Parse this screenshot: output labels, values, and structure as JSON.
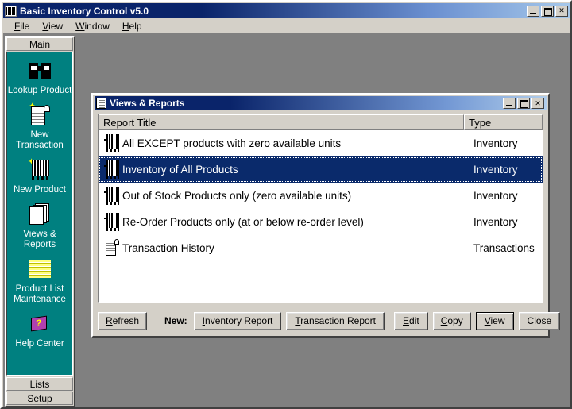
{
  "app": {
    "title": "Basic Inventory Control v5.0",
    "icon": "barcode-icon",
    "window_controls": {
      "minimize": "_",
      "maximize": "□",
      "close": "✕"
    }
  },
  "menubar": {
    "items": [
      {
        "label": "File",
        "accel": "F"
      },
      {
        "label": "View",
        "accel": "V"
      },
      {
        "label": "Window",
        "accel": "W"
      },
      {
        "label": "Help",
        "accel": "H"
      }
    ]
  },
  "sidebar": {
    "top_tab": "Main",
    "bottom_tabs": [
      "Lists",
      "Setup"
    ],
    "items": [
      {
        "label": "Lookup Product",
        "icon": "binoculars-icon"
      },
      {
        "label": "New\nTransaction",
        "icon": "new-transaction-scroll-icon"
      },
      {
        "label": "New Product",
        "icon": "new-product-barcode-icon"
      },
      {
        "label": "Views & Reports",
        "icon": "pages-icon"
      },
      {
        "label": "Product List\nMaintenance",
        "icon": "product-list-stripes-icon"
      },
      {
        "label": "Help Center",
        "icon": "help-book-icon"
      }
    ]
  },
  "dialog": {
    "title": "Views & Reports",
    "icon": "clipboard-icon",
    "window_controls": {
      "minimize": "_",
      "maximize": "□",
      "close": "✕"
    },
    "columns": [
      {
        "key": "title",
        "label": "Report Title"
      },
      {
        "key": "type",
        "label": "Type"
      }
    ],
    "rows": [
      {
        "title": "All EXCEPT products with zero available units",
        "type": "Inventory",
        "icon": "barcode-row-icon",
        "selected": false
      },
      {
        "title": "Inventory of All Products",
        "type": "Inventory",
        "icon": "barcode-row-icon",
        "selected": true
      },
      {
        "title": "Out of Stock Products only (zero available units)",
        "type": "Inventory",
        "icon": "barcode-row-icon",
        "selected": false
      },
      {
        "title": "Re-Order Products only (at or below re-order level)",
        "type": "Inventory",
        "icon": "barcode-row-icon",
        "selected": false
      },
      {
        "title": "Transaction History",
        "type": "Transactions",
        "icon": "scroll-row-icon",
        "selected": false
      }
    ],
    "buttons": {
      "refresh": {
        "label": "Refresh",
        "accel": "R"
      },
      "new_label": "New:",
      "inventory_report": {
        "label": "Inventory Report",
        "accel": "I"
      },
      "transaction_report": {
        "label": "Transaction Report",
        "accel": "T"
      },
      "edit": {
        "label": "Edit",
        "accel": "E"
      },
      "copy": {
        "label": "Copy",
        "accel": "C"
      },
      "view": {
        "label": "View",
        "accel": "V",
        "default": true
      },
      "close": {
        "label": "Close",
        "accel": ""
      }
    }
  },
  "colors": {
    "titlebar_start": "#0a246a",
    "titlebar_end": "#a6c8ea",
    "sidebar_teal": "#008080",
    "face": "#d4d0c8",
    "selection": "#0a2a6b",
    "mdi_background": "#808080"
  }
}
